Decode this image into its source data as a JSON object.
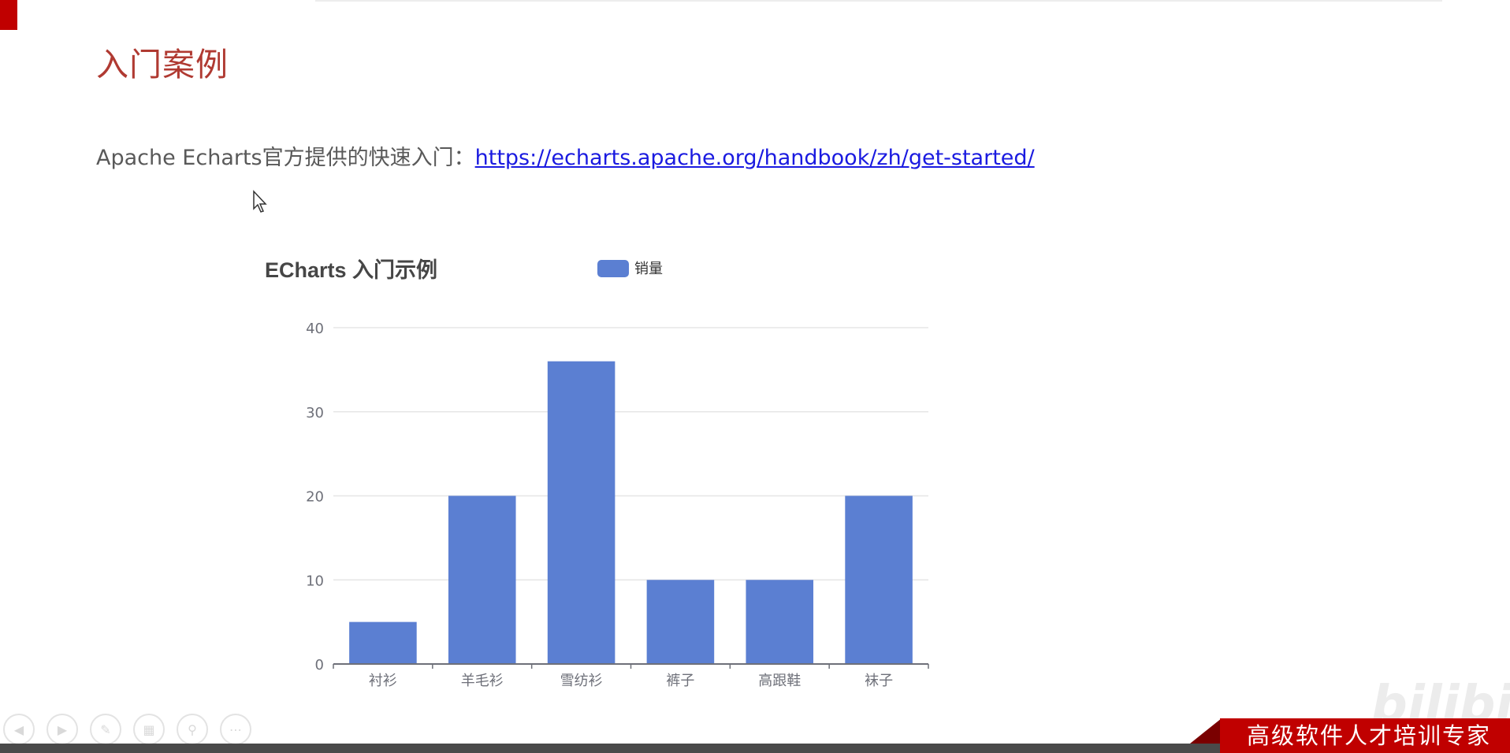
{
  "slide": {
    "title": "入门案例",
    "intro_text": "Apache Echarts官方提供的快速入门：",
    "intro_link": "https://echarts.apache.org/handbook/zh/get-started/"
  },
  "colors": {
    "accent_red": "#c00000",
    "title_red": "#b03a32",
    "link_blue": "#1a1ae0",
    "bar_blue": "#5b7fd2"
  },
  "chart_data": {
    "type": "bar",
    "title": "ECharts 入门示例",
    "legend": [
      "销量"
    ],
    "legend_position": "top-center",
    "categories": [
      "衬衫",
      "羊毛衫",
      "雪纺衫",
      "裤子",
      "高跟鞋",
      "袜子"
    ],
    "series": [
      {
        "name": "销量",
        "values": [
          5,
          20,
          36,
          10,
          10,
          20
        ]
      }
    ],
    "ylim": [
      0,
      40
    ],
    "yticks": [
      0,
      10,
      20,
      30,
      40
    ],
    "grid": true
  },
  "nav": {
    "icons": [
      "prev-icon",
      "next-icon",
      "pen-icon",
      "slides-icon",
      "zoom-icon",
      "more-icon"
    ]
  },
  "brand": {
    "banner_text": "高级软件人才培训专家",
    "watermark_text": "bilibili"
  }
}
